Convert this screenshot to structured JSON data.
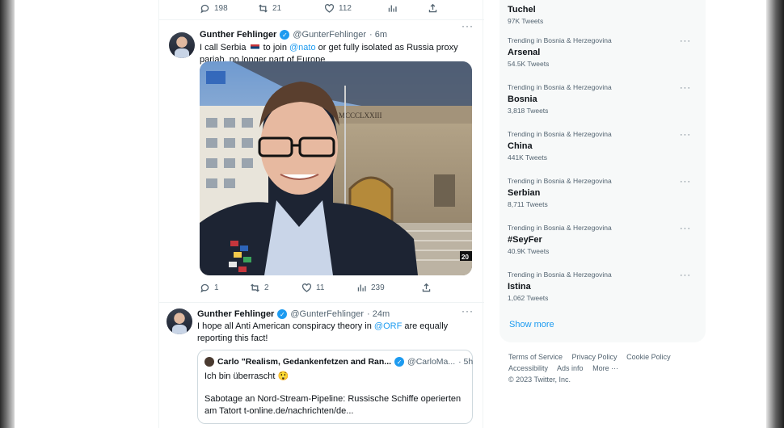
{
  "top_actions": {
    "replies": "198",
    "retweets": "21",
    "likes": "112"
  },
  "tweet1": {
    "name": "Gunther Fehlinger",
    "handle": "@GunterFehlinger",
    "time": "· 6m",
    "text_before_flag": "I call Serbia",
    "text_mid": " to join ",
    "mention": "@nato",
    "text_after": " or get fully isolated as Russia proxy pariah, no longer part of Europe",
    "photo_inscription": "MCCCLXXIII",
    "photo_badge": "20",
    "actions": {
      "replies": "1",
      "retweets": "2",
      "likes": "11",
      "views": "239"
    }
  },
  "tweet2": {
    "name": "Gunther Fehlinger",
    "handle": "@GunterFehlinger",
    "time": "· 24m",
    "text_before": "I hope all Anti American conspiracy theory in ",
    "mention": "@ORF",
    "text_after": " are equally reporting this fact!",
    "quote": {
      "name": "Carlo \"Realism, Gedankenfetzen and Ran...",
      "handle": "@CarloMa...",
      "time": "· 5h",
      "line1": "Ich bin überrascht",
      "emoji": "😲",
      "line2": "Sabotage an Nord-Stream-Pipeline: Russische Schiffe operierten am Tatort t-online.de/nachrichten/de..."
    }
  },
  "trends": [
    {
      "context": "",
      "name": "Tuchel",
      "count": "97K Tweets"
    },
    {
      "context": "Trending in Bosnia & Herzegovina",
      "name": "Arsenal",
      "count": "54.5K Tweets"
    },
    {
      "context": "Trending in Bosnia & Herzegovina",
      "name": "Bosnia",
      "count": "3,818 Tweets"
    },
    {
      "context": "Trending in Bosnia & Herzegovina",
      "name": "China",
      "count": "441K Tweets"
    },
    {
      "context": "Trending in Bosnia & Herzegovina",
      "name": "Serbian",
      "count": "8,711 Tweets"
    },
    {
      "context": "Trending in Bosnia & Herzegovina",
      "name": "#SeyFer",
      "count": "40.9K Tweets"
    },
    {
      "context": "Trending in Bosnia & Herzegovina",
      "name": "Istina",
      "count": "1,062 Tweets"
    }
  ],
  "show_more": "Show more",
  "footer": {
    "terms": "Terms of Service",
    "privacy": "Privacy Policy",
    "cookie": "Cookie Policy",
    "accessibility": "Accessibility",
    "ads": "Ads info",
    "more": "More ···",
    "copyright": "© 2023 Twitter, Inc."
  },
  "colors": {
    "accent": "#1d9bf0",
    "text": "#0f1419",
    "secondary": "#536471",
    "sidebar_bg": "#f7f9f9"
  }
}
